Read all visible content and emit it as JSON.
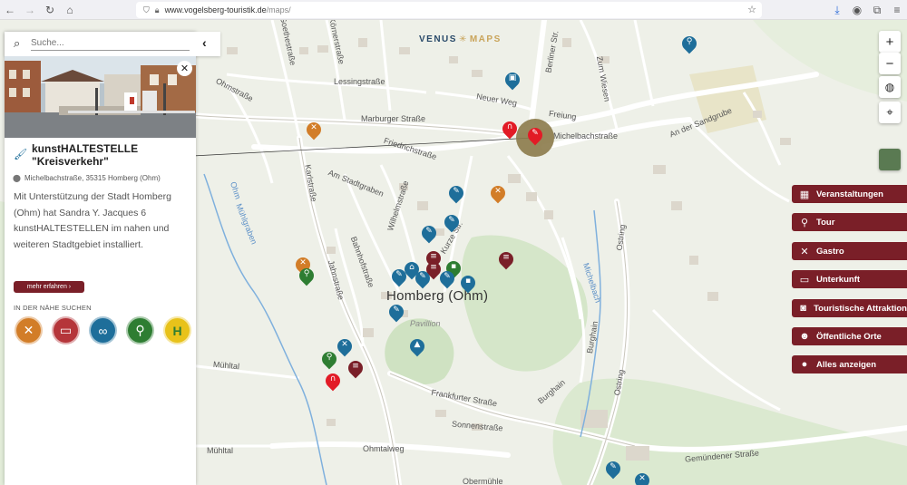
{
  "browser": {
    "url_host": "www.vogelsberg-touristik.de",
    "url_path": "/maps/"
  },
  "logo": {
    "left": "VENUS",
    "right": "MAPS"
  },
  "search": {
    "placeholder": "Suche..."
  },
  "detail": {
    "title_line1": "kunstHALTESTELLE",
    "title_line2": "\"Kreisverkehr\"",
    "address": "Michelbachstraße, 35315 Homberg (Ohm)",
    "description": "Mit Unterstützung der Stadt Homberg (Ohm) hat Sandra Y. Jacques 6 kunstHALTESTELLEN im nahen und weiteren Stadtgebiet installiert.",
    "more_label": "mehr erfahren",
    "nearby_label": "IN DER NÄHE SUCHEN",
    "nearby": [
      {
        "name": "gastro",
        "icon": "fork-knife-icon",
        "color": "#d27d28"
      },
      {
        "name": "unterkunft",
        "icon": "bed-icon",
        "color": "#b5353a"
      },
      {
        "name": "attraktion",
        "icon": "binoculars-icon",
        "color": "#1e6e9a"
      },
      {
        "name": "tour",
        "icon": "route-icon",
        "color": "#2e7d32"
      },
      {
        "name": "haltestelle",
        "icon": "bus-stop-icon",
        "color": "#e8c21a"
      }
    ]
  },
  "map": {
    "city": "Homberg (Ohm)",
    "place": "Pavillion",
    "streets": {
      "ohmstrasse": "Ohmstraße",
      "marburger": "Marburger Straße",
      "friedrich": "Friedrichstraße",
      "stadtgraben": "Am Stadtgraben",
      "wilhelm": "Wilhelmstraße",
      "karl": "Karlstraße",
      "bahnhof": "Bahnhofstraße",
      "jahn": "Jahnstraße",
      "muehltal": "Mühltal",
      "muehltal2": "Mühltal",
      "frankfurter": "Frankfurter Straße",
      "sonnen": "Sonnenstraße",
      "ohmtal": "Ohmtalweg",
      "gemuenden": "Gemündener Straße",
      "sandgrube": "An der Sandgrube",
      "ostring": "Ostring",
      "ostring2": "Ostring",
      "michelbach": "Michelbachstraße",
      "freiung": "Freiung",
      "neuer": "Neuer Weg",
      "lessing": "Lessingstraße",
      "goethe": "Goethestraße",
      "koerner": "Körnerstraße",
      "berliner": "Berliner Str.",
      "zumwiesen": "Zum Wiesen",
      "burghain": "Burghain",
      "burghain2": "Burghain",
      "obermuehle": "Obermühle",
      "kurzestr": "Kurze Str."
    },
    "water": {
      "ohm": "Ohm",
      "muehlgraben": "Mühlgraben",
      "michelbach": "Michelbach"
    }
  },
  "categories": [
    {
      "label": "Veranstaltungen",
      "icon": "calendar-icon"
    },
    {
      "label": "Tour",
      "icon": "route-icon"
    },
    {
      "label": "Gastro",
      "icon": "fork-knife-icon"
    },
    {
      "label": "Unterkunft",
      "icon": "bed-icon"
    },
    {
      "label": "Touristische Attraktion",
      "icon": "camera-icon"
    },
    {
      "label": "Öffentliche Orte",
      "icon": "people-icon"
    },
    {
      "label": "Alles anzeigen",
      "icon": "circle-icon"
    }
  ],
  "colors": {
    "accent": "#7a1f28",
    "map_bg": "#eef0e8",
    "green_area": "#d9e8cf"
  }
}
